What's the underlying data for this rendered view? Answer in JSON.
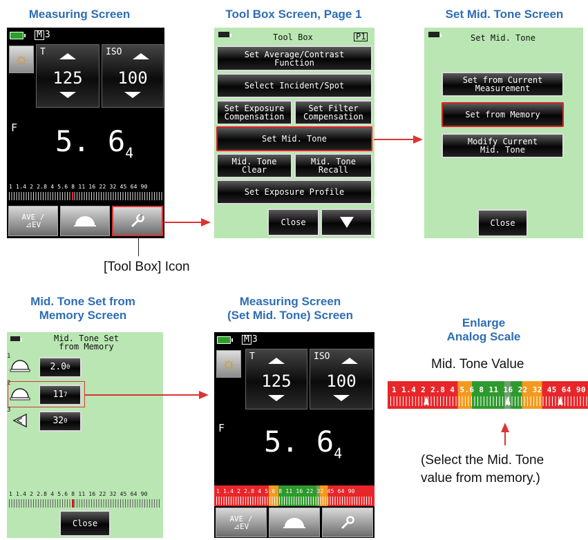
{
  "captions": {
    "measuring": "Measuring Screen",
    "toolbox": "Tool Box Screen, Page 1",
    "midtone": "Set Mid. Tone Screen",
    "memory_l1": "Mid. Tone Set from",
    "memory_l2": "Memory Screen",
    "measuring_mt_l1": "Measuring Screen",
    "measuring_mt_l2": "(Set Mid. Tone) Screen",
    "enlarge_l1": "Enlarge",
    "enlarge_l2": "Analog Scale"
  },
  "notes": {
    "toolbox_icon": "[Tool Box] Icon",
    "midtone_value": "Mid. Tone Value",
    "select_l1": "(Select the Mid. Tone",
    "select_l2": "value from memory.)"
  },
  "meter": {
    "memory_chip": "M",
    "memory_num": "3",
    "t_label": "T",
    "iso_label": "ISO",
    "t_value": "125",
    "iso_value": "100",
    "f_label": "F",
    "f_value": "5. 6",
    "f_sub": "4",
    "scale": "1 1.4 2 2.8 4 5.6 8 11 16 22 32 45 64 90",
    "ave_label": "AVE /",
    "ev_label": "⊿EV"
  },
  "toolbox": {
    "title": "Tool Box",
    "page": "P1",
    "buttons": {
      "avg_contrast": "Set Average/Contrast\nFunction",
      "incident_spot": "Select Incident/Spot",
      "exposure_comp": "Set Exposure\nCompensation",
      "filter_comp": "Set Filter\nCompensation",
      "mid_tone": "Set Mid. Tone",
      "mid_clear": "Mid. Tone\nClear",
      "mid_recall": "Mid. Tone\nRecall",
      "profile": "Set Exposure Profile",
      "close": "Close"
    }
  },
  "midtone": {
    "title": "Set Mid. Tone",
    "from_current": "Set from Current\nMeasurement",
    "from_memory": "Set from Memory",
    "modify": "Modify Current\nMid. Tone",
    "close": "Close"
  },
  "memory": {
    "title": "Mid. Tone Set\nfrom Memory",
    "items": [
      {
        "num": "1",
        "value": "2.0",
        "sub": "0"
      },
      {
        "num": "2",
        "value": "11",
        "sub": "7"
      },
      {
        "num": "3",
        "value": "32",
        "sub": "0"
      }
    ],
    "close": "Close"
  },
  "colors": {
    "caption": "#2e6db4",
    "green_screen": "#b9e6b2",
    "highlight": "#dd3333",
    "scale_red": "#e8262a",
    "scale_orange": "#f39a1e",
    "scale_green": "#2e9a2e"
  },
  "icons": [
    "battery-icon",
    "sun-icon",
    "incident-dome-icon",
    "wrench-icon",
    "down-arrow-icon",
    "spot-icon"
  ]
}
